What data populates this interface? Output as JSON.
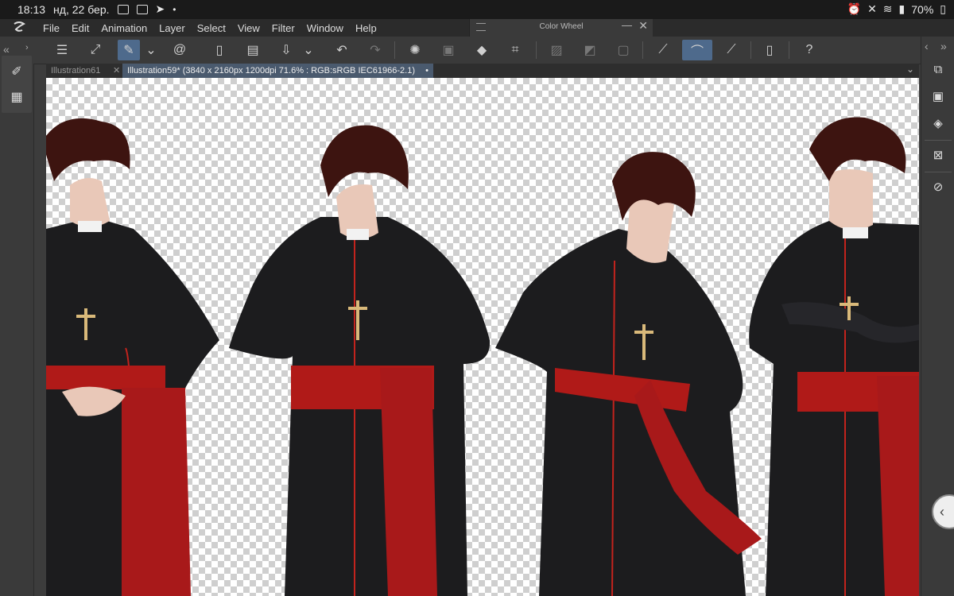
{
  "status": {
    "time": "18:13",
    "date": "нд, 22 бер.",
    "battery": "70%"
  },
  "menu": {
    "items": [
      "File",
      "Edit",
      "Animation",
      "Layer",
      "Select",
      "View",
      "Filter",
      "Window",
      "Help"
    ]
  },
  "panel": {
    "title": "Color Wheel"
  },
  "tabs": [
    {
      "label": "Illustration61",
      "active": false
    },
    {
      "label": "Illustration59* (3840 x 2160px 1200dpi 71.6% : RGB:sRGB IEC61966-2.1)",
      "active": true
    }
  ],
  "toolbar": {
    "icons": [
      "menu-icon",
      "fit-icon",
      "edit-mode-icon",
      "dropdown-icon",
      "spiral-icon",
      "new-file-icon",
      "open-folder-icon",
      "save-icon",
      "dropdown-icon",
      "undo-icon",
      "redo-icon",
      "loading-icon",
      "selection-icon",
      "fill-icon",
      "transform-icon",
      "deselect-icon",
      "invert-icon",
      "show-selection-icon",
      "pen-icon",
      "brush-icon",
      "eraser-icon",
      "phone-icon",
      "help-icon"
    ]
  },
  "colors": {
    "cassock": "#1c1c1e",
    "sash": "#b01a18",
    "piping": "#c3231d",
    "hair": "#3d1410",
    "skin": "#e9c8b8",
    "gold": "#d9b97a",
    "collar": "#f2f2f2"
  }
}
